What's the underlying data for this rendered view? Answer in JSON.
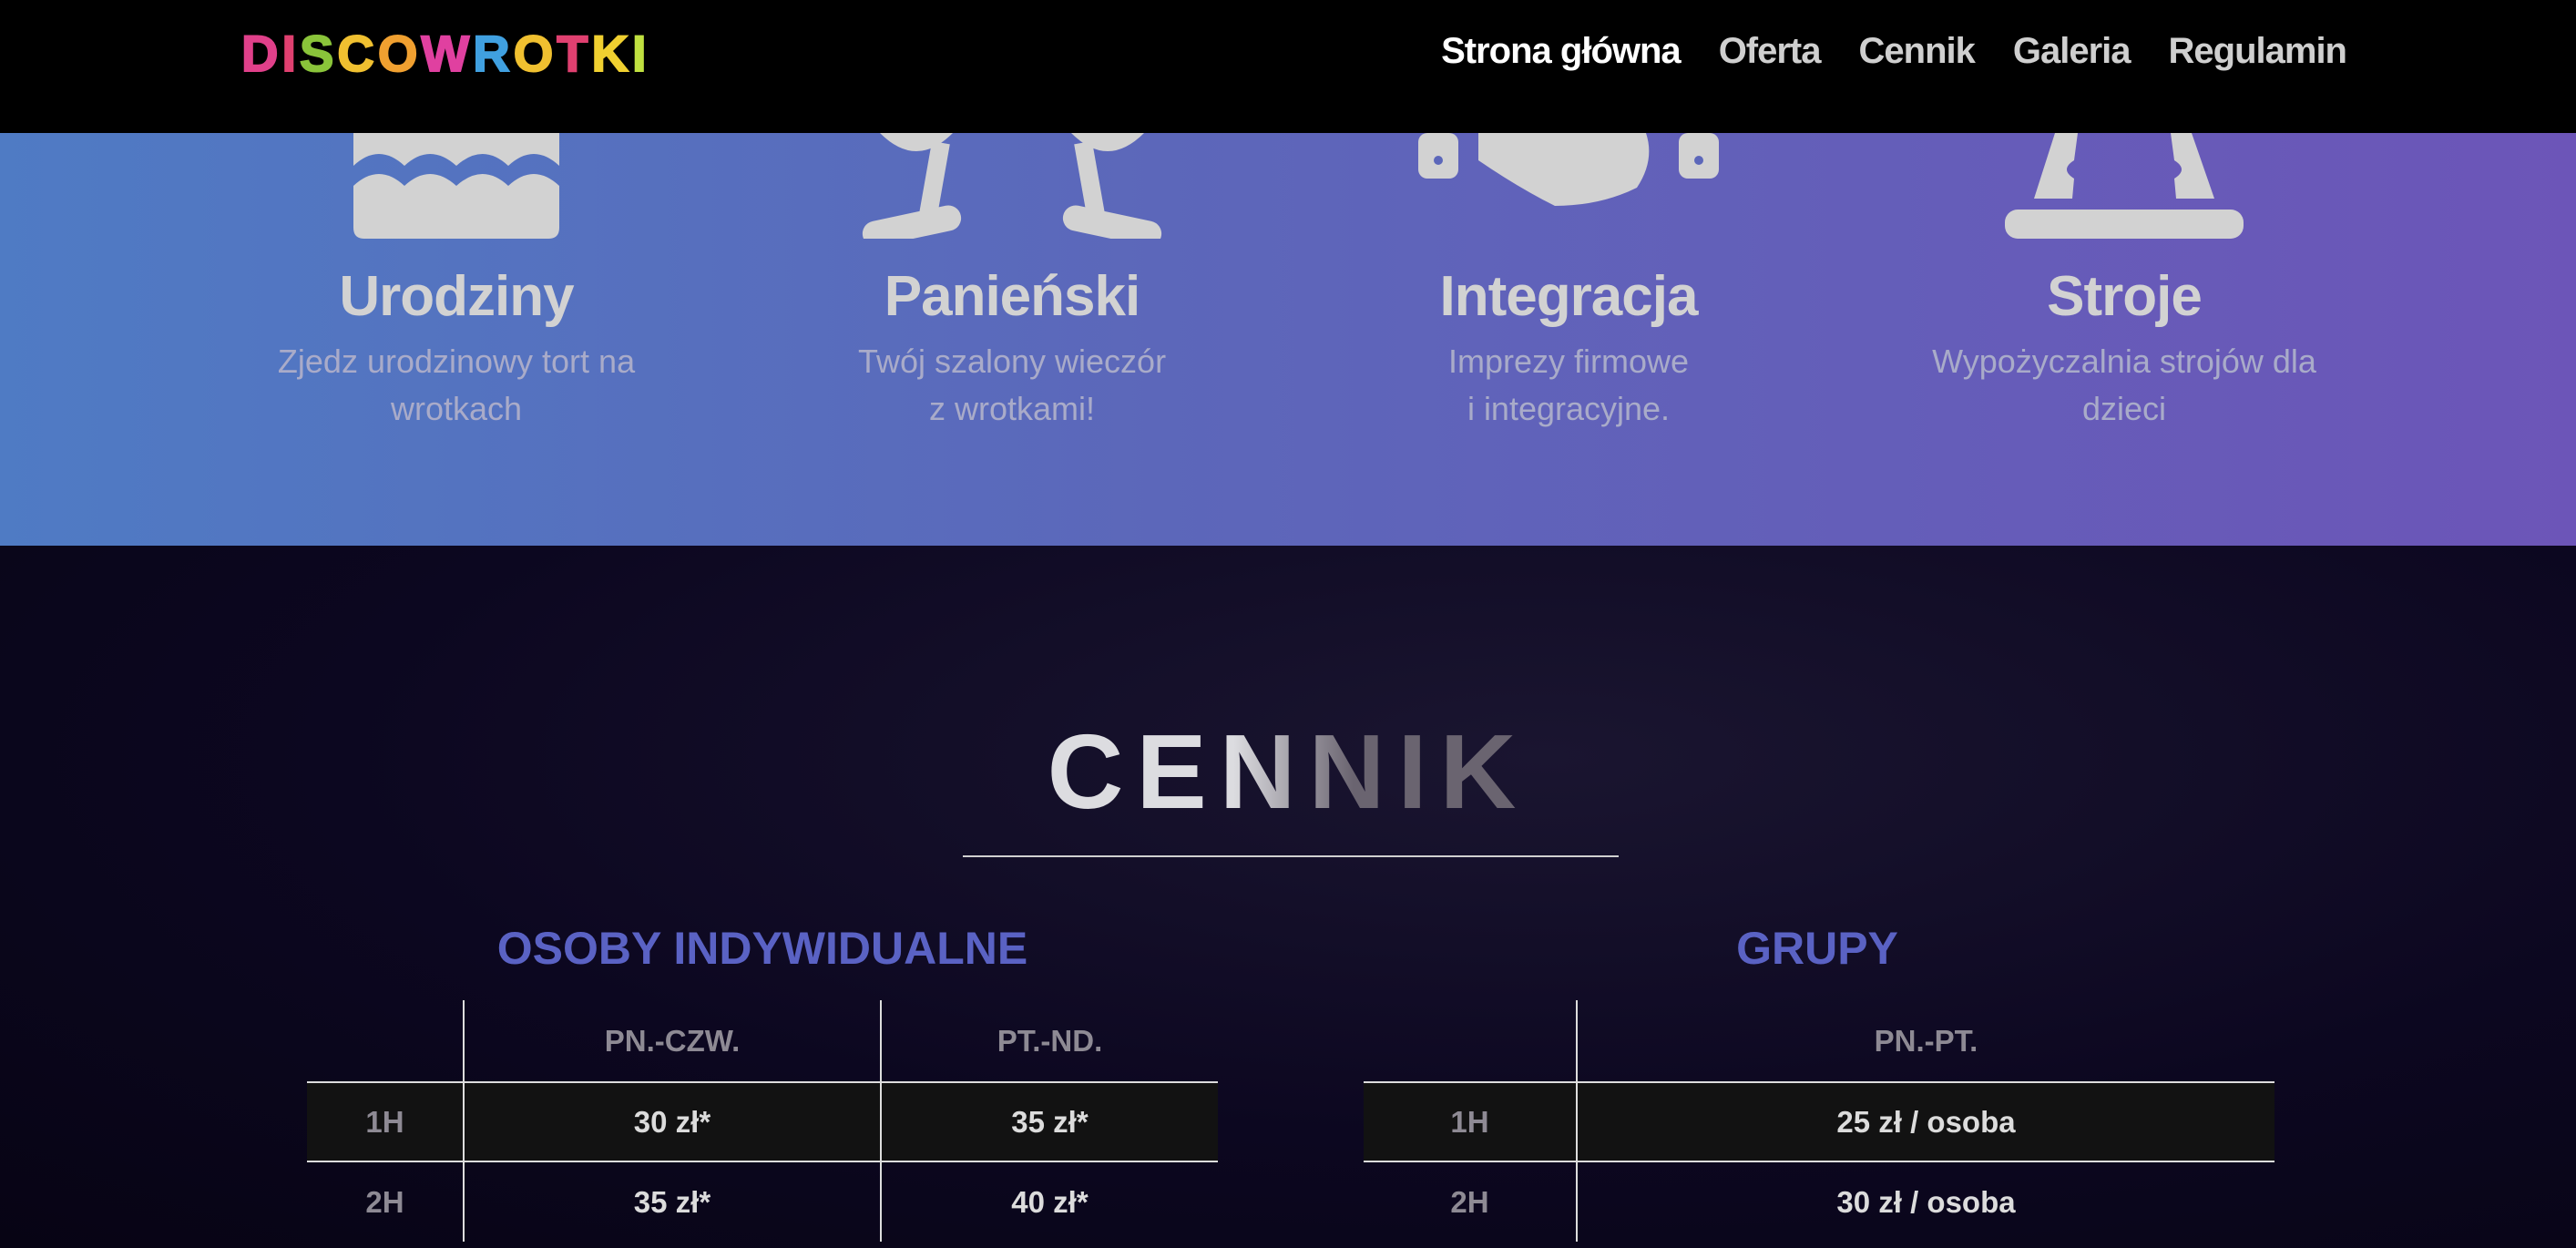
{
  "header": {
    "logo": "DISCOWROTKI",
    "nav": [
      "Strona główna",
      "Oferta",
      "Cennik",
      "Galeria",
      "Regulamin"
    ]
  },
  "offers": [
    {
      "icon": "cake-icon",
      "title": "Urodziny",
      "desc1": "Zjedz urodzinowy tort na",
      "desc2": "wrotkach"
    },
    {
      "icon": "glasses-icon",
      "title": "Panieński",
      "desc1": "Twój szalony wieczór",
      "desc2": "z wrotkami!"
    },
    {
      "icon": "handshake-icon",
      "title": "Integracja",
      "desc1": "Imprezy firmowe",
      "desc2": "i integracyjne."
    },
    {
      "icon": "costume-icon",
      "title": "Stroje",
      "desc1": "Wypożyczalnia strojów dla",
      "desc2": "dzieci"
    }
  ],
  "pricing": {
    "title": "CENNIK",
    "individual": {
      "heading": "OSOBY INDYWIDUALNE",
      "cols": [
        "PN.-CZW.",
        "PT.-ND."
      ],
      "rows": [
        [
          "1H",
          "30 zł*",
          "35 zł*"
        ],
        [
          "2H",
          "35 zł*",
          "40 zł*"
        ]
      ]
    },
    "groups": {
      "heading": "GRUPY",
      "cols": [
        "PN.-PT."
      ],
      "rows": [
        [
          "1H",
          "25 zł / osoba"
        ],
        [
          "2H",
          "30 zł / osoba"
        ]
      ]
    }
  },
  "colors": {
    "accent": "#5a62c4",
    "band_left": "#4f7bc4",
    "band_right": "#6c55b8"
  }
}
